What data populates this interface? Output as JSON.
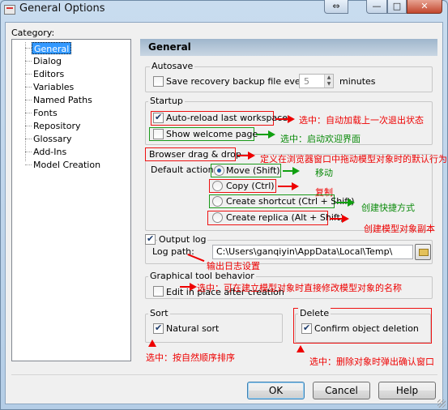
{
  "window": {
    "title": "General Options"
  },
  "caption_buttons": {
    "restore_glyph": "⇔",
    "minimize_glyph": "—",
    "maximize_glyph": "□",
    "close_glyph": "✕"
  },
  "category": {
    "label": "Category:",
    "items": [
      "General",
      "Dialog",
      "Editors",
      "Variables",
      "Named Paths",
      "Fonts",
      "Repository",
      "Glossary",
      "Add-Ins",
      "Model Creation"
    ],
    "selected": "General"
  },
  "panel": {
    "title": "General"
  },
  "autosave": {
    "group_label": "Autosave",
    "checkbox_label": "Save recovery backup file every",
    "checked": false,
    "interval_value": "5",
    "unit_label": "minutes"
  },
  "startup": {
    "group_label": "Startup",
    "auto_reload_label": "Auto-reload last workspace",
    "auto_reload_checked": true,
    "show_welcome_label": "Show welcome page",
    "show_welcome_checked": false
  },
  "browser_drag": {
    "group_label": "Browser drag & drop",
    "default_action_label": "Default action:",
    "options": [
      "Move (Shift)",
      "Copy (Ctrl)",
      "Create shortcut (Ctrl + Shift)",
      "Create replica (Alt + Shift)"
    ],
    "selected": "Move (Shift)"
  },
  "output_log": {
    "checkbox_label": "Output log",
    "checked": true,
    "path_label": "Log path:",
    "path_value": "C:\\Users\\ganqiyin\\AppData\\Local\\Temp\\"
  },
  "graphical": {
    "group_label": "Graphical tool behavior",
    "checkbox_label": "Edit in place after creation",
    "checked": false
  },
  "sort": {
    "group_label": "Sort",
    "checkbox_label": "Natural sort",
    "checked": true
  },
  "delete": {
    "group_label": "Delete",
    "checkbox_label": "Confirm object deletion",
    "checked": true
  },
  "buttons": {
    "ok": "OK",
    "cancel": "Cancel",
    "help": "Help"
  },
  "annotations": {
    "auto_reload": "选中：自动加载上一次退出状态",
    "show_welcome": "选中：启动欢迎界面",
    "browser_drag": "定义在浏览器窗口中拖动模型对象时的默认行为",
    "move": "移动",
    "copy": "复制",
    "create_shortcut": "创建快捷方式",
    "create_replica": "创建模型对象副本",
    "output_log": "输出日志设置",
    "edit_in_place": "选中：可在建立模型对象时直接修改模型对象的名称",
    "natural_sort": "选中：按自然顺序排序",
    "confirm_delete": "选中：删除对象时弹出确认窗口"
  },
  "colors": {
    "annotation_red": "#ee0000",
    "annotation_green": "#11a011",
    "selection_blue": "#3399ff"
  }
}
